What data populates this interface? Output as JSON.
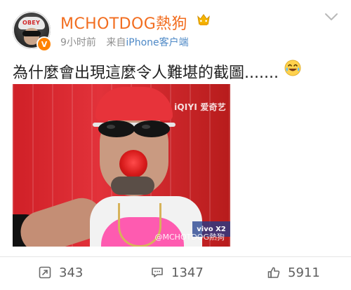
{
  "post": {
    "author": {
      "name": "MCHOTDOG熱狗",
      "avatar_icon": "avatar",
      "verified_icon": "verified-badge-icon",
      "vip_icon": "vip-crown-icon"
    },
    "meta": {
      "time": "9小时前",
      "source_prefix": "来自",
      "device": "iPhone客户端"
    },
    "text": "為什麼會出現這麼令人難堪的截圖.......",
    "emoji_icon": "laugh-cry-icon",
    "image": {
      "watermark_top": "iQIYI 爱奇艺",
      "watermark_bottom": "@MCHOTDOG熱狗",
      "sponsor_tag": "vivo X2"
    }
  },
  "actions": {
    "repost": {
      "count": "343",
      "icon": "repost-icon"
    },
    "comment": {
      "count": "1347",
      "icon": "comment-icon"
    },
    "like": {
      "count": "5911",
      "icon": "thumbs-up-icon"
    }
  },
  "colors": {
    "username": "#f26d1f",
    "device_link": "#4d88c6",
    "meta_gray": "#8f8f8f"
  }
}
